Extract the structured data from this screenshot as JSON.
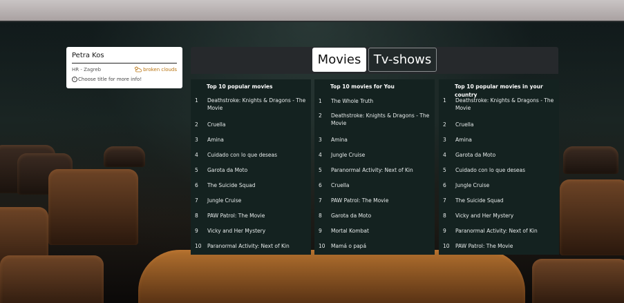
{
  "user": {
    "name": "Petra Kos",
    "location": "HR - Zagreb",
    "weather": "broken clouds",
    "weather_icon": "cloud-sun-icon",
    "hint": "Choose title for more info!"
  },
  "tabs": [
    {
      "label": "Movies",
      "active": true
    },
    {
      "label": "Tv-shows",
      "active": false
    }
  ],
  "columns": [
    {
      "title": "Top 10 popular movies",
      "items": [
        {
          "rank": "1",
          "title": "Deathstroke: Knights & Dragons - The Movie"
        },
        {
          "rank": "2",
          "title": "Cruella"
        },
        {
          "rank": "3",
          "title": "Amina"
        },
        {
          "rank": "4",
          "title": "Cuidado con lo que deseas"
        },
        {
          "rank": "5",
          "title": "Garota da Moto"
        },
        {
          "rank": "6",
          "title": "The Suicide Squad"
        },
        {
          "rank": "7",
          "title": "Jungle Cruise"
        },
        {
          "rank": "8",
          "title": "PAW Patrol: The Movie"
        },
        {
          "rank": "9",
          "title": "Vicky and Her Mystery"
        },
        {
          "rank": "10",
          "title": "Paranormal Activity: Next of Kin"
        }
      ]
    },
    {
      "title": "Top 10 movies for You",
      "items": [
        {
          "rank": "1",
          "title": "The Whole Truth"
        },
        {
          "rank": "2",
          "title": "Deathstroke: Knights & Dragons - The Movie"
        },
        {
          "rank": "3",
          "title": "Amina"
        },
        {
          "rank": "4",
          "title": "Jungle Cruise"
        },
        {
          "rank": "5",
          "title": "Paranormal Activity: Next of Kin"
        },
        {
          "rank": "6",
          "title": "Cruella"
        },
        {
          "rank": "7",
          "title": "PAW Patrol: The Movie"
        },
        {
          "rank": "8",
          "title": "Garota da Moto"
        },
        {
          "rank": "9",
          "title": "Mortal Kombat"
        },
        {
          "rank": "10",
          "title": "Mamá o papá"
        }
      ]
    },
    {
      "title": "Top 10 popular movies in your country",
      "items": [
        {
          "rank": "1",
          "title": "Deathstroke: Knights & Dragons - The Movie"
        },
        {
          "rank": "2",
          "title": "Cruella"
        },
        {
          "rank": "3",
          "title": "Amina"
        },
        {
          "rank": "4",
          "title": "Garota da Moto"
        },
        {
          "rank": "5",
          "title": "Cuidado con lo que deseas"
        },
        {
          "rank": "6",
          "title": "Jungle Cruise"
        },
        {
          "rank": "7",
          "title": "The Suicide Squad"
        },
        {
          "rank": "8",
          "title": "Vicky and Her Mystery"
        },
        {
          "rank": "9",
          "title": "Paranormal Activity: Next of Kin"
        },
        {
          "rank": "10",
          "title": "PAW Patrol: The Movie"
        }
      ]
    }
  ]
}
